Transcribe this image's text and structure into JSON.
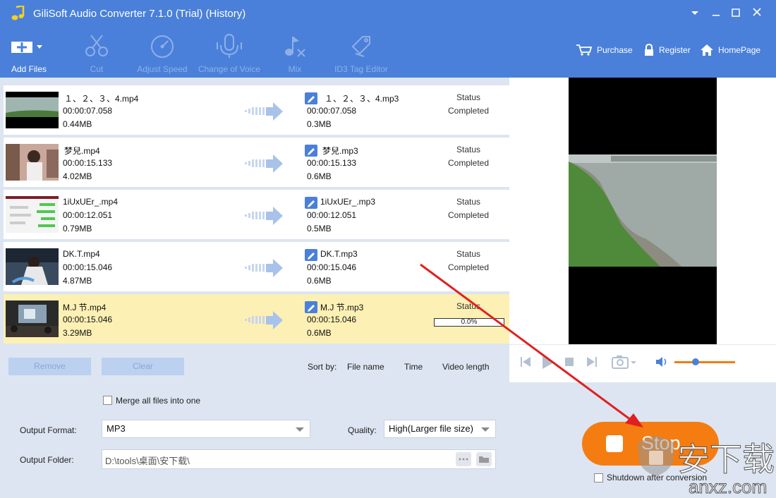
{
  "window": {
    "title": "GiliSoft Audio Converter 7.1.0 (Trial) (History)"
  },
  "toolbar": {
    "add_files": "Add Files",
    "cut": "Cut",
    "adjust_speed": "Adjust Speed",
    "change_voice": "Change of Voice",
    "mix": "Mix",
    "id3": "ID3 Tag Editor",
    "purchase": "Purchase",
    "register": "Register",
    "homepage": "HomePage"
  },
  "files": [
    {
      "src_name": "１、２、３、4.mp4",
      "src_time": "00:00:07.058",
      "src_size": "0.44MB",
      "dst_name": "１、２、３、4.mp3",
      "dst_time": "00:00:07.058",
      "dst_size": "0.3MB",
      "status_label": "Status",
      "status": "Completed"
    },
    {
      "src_name": "梦兒.mp4",
      "src_time": "00:00:15.133",
      "src_size": "4.02MB",
      "dst_name": "梦兒.mp3",
      "dst_time": "00:00:15.133",
      "dst_size": "0.6MB",
      "status_label": "Status",
      "status": "Completed"
    },
    {
      "src_name": "1iUxUEr_.mp4",
      "src_time": "00:00:12.051",
      "src_size": "0.79MB",
      "dst_name": "1iUxUEr_.mp3",
      "dst_time": "00:00:12.051",
      "dst_size": "0.5MB",
      "status_label": "Status",
      "status": "Completed"
    },
    {
      "src_name": "DK.T.mp4",
      "src_time": "00:00:15.046",
      "src_size": "4.87MB",
      "dst_name": "DK.T.mp3",
      "dst_time": "00:00:15.046",
      "dst_size": "0.6MB",
      "status_label": "Status",
      "status": "Completed"
    },
    {
      "src_name": "M.J 节.mp4",
      "src_time": "00:00:15.046",
      "src_size": "3.29MB",
      "dst_name": "M.J 节.mp3",
      "dst_time": "00:00:15.046",
      "dst_size": "0.6MB",
      "status_label": "Status",
      "status": "0.0%",
      "progress": 0.0
    }
  ],
  "list_actions": {
    "remove": "Remove",
    "clear": "Clear",
    "sort_by": "Sort by:",
    "sort_file_name": "File name",
    "sort_time": "Time",
    "sort_video_length": "Video length"
  },
  "settings": {
    "merge_label": "Merge all files into one",
    "output_format_label": "Output Format:",
    "output_format_value": "MP3",
    "quality_label": "Quality:",
    "quality_value": "High(Larger file size)",
    "output_folder_label": "Output Folder:",
    "output_folder_value": "D:\\tools\\桌面\\安下载\\",
    "shutdown_label": "Shutdown after conversion",
    "stop_label": "Stop"
  },
  "player": {
    "volume": 0.35
  },
  "watermark": {
    "text": "安下载",
    "domain": "anxz.com"
  },
  "colors": {
    "header": "#4a80da",
    "stop": "#f57c11",
    "active_row": "#fdf0b4"
  }
}
